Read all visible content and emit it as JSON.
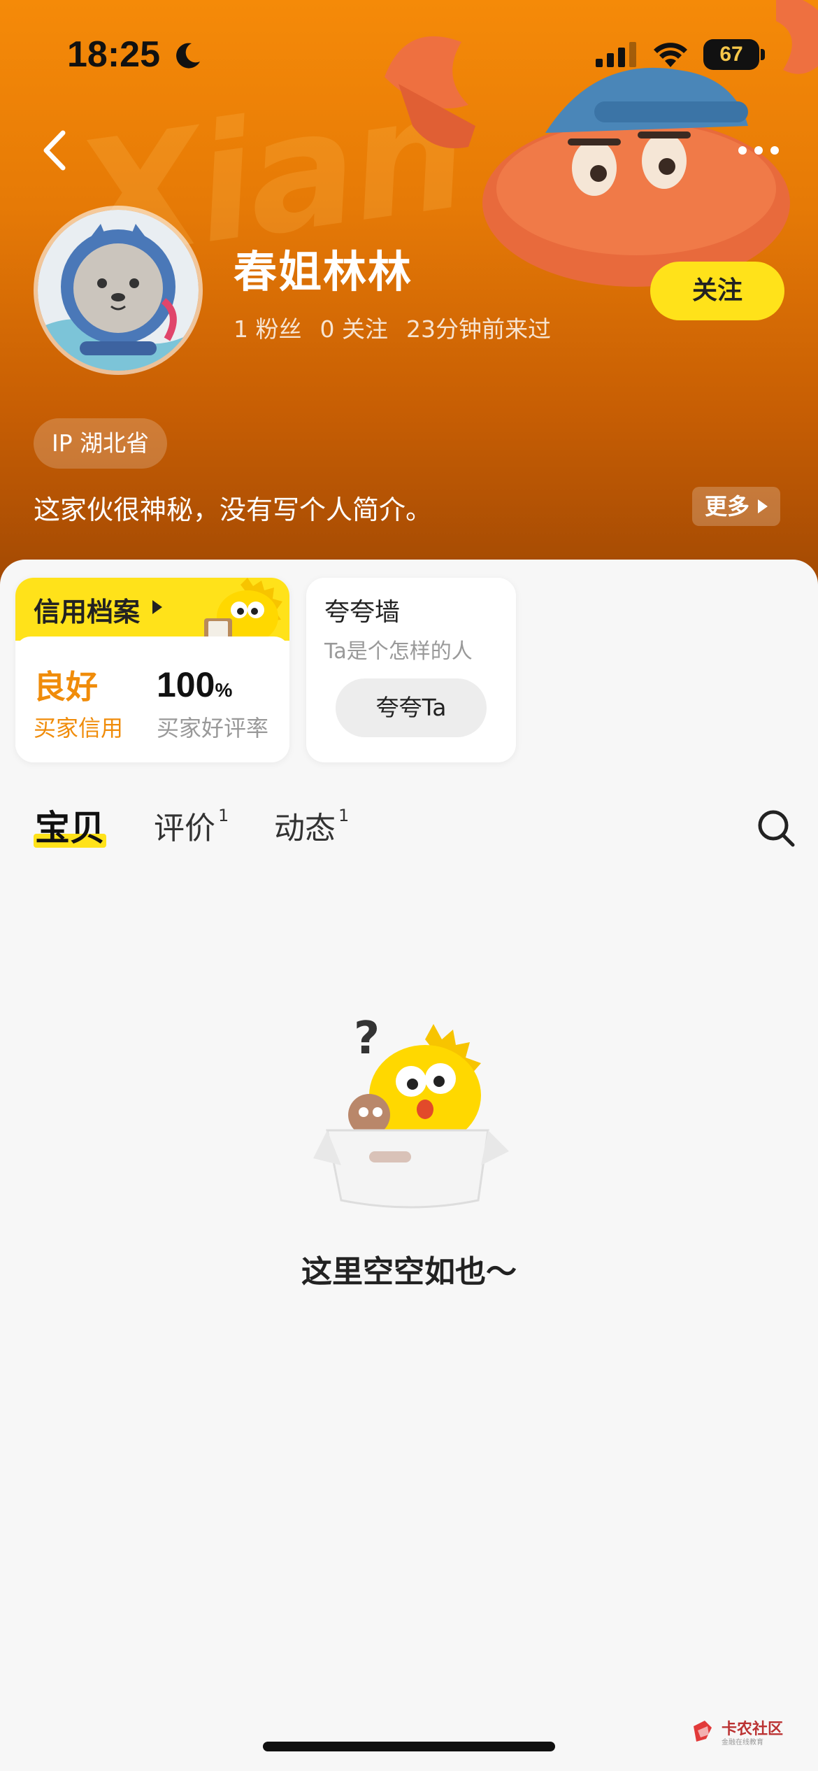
{
  "status_bar": {
    "time": "18:25",
    "battery": "67",
    "icons": [
      "moon-icon",
      "signal-icon",
      "wifi-icon",
      "battery-icon"
    ]
  },
  "nav": {
    "back_icon": "chevron-left-icon",
    "more_icon": "more-dots-icon"
  },
  "header": {
    "background_watermark": "Xian",
    "username": "春姐林林",
    "fans": "1 粉丝",
    "following": "0 关注",
    "last_seen": "23分钟前来过",
    "follow_label": "关注",
    "ip_location": "IP 湖北省",
    "bio": "这家伙很神秘，没有写个人简介。",
    "more_label": "更多"
  },
  "credit_card": {
    "title": "信用档案",
    "level": "良好",
    "level_label": "买家信用",
    "rate_value": "100",
    "rate_unit": "%",
    "rate_label": "买家好评率"
  },
  "praise_card": {
    "title": "夸夸墙",
    "subtitle": "Ta是个怎样的人",
    "button_label": "夸夸Ta"
  },
  "tabs": [
    {
      "label": "宝贝",
      "count": "",
      "active": true
    },
    {
      "label": "评价",
      "count": "1",
      "active": false
    },
    {
      "label": "动态",
      "count": "1",
      "active": false
    }
  ],
  "empty_state": {
    "message": "这里空空如也～"
  },
  "watermark": {
    "name": "卡农社区",
    "sub": "金融在线教育"
  },
  "colors": {
    "brand_yellow": "#ffe21a",
    "header_orange": "#f58a08",
    "credit_orange": "#f08c0a"
  }
}
